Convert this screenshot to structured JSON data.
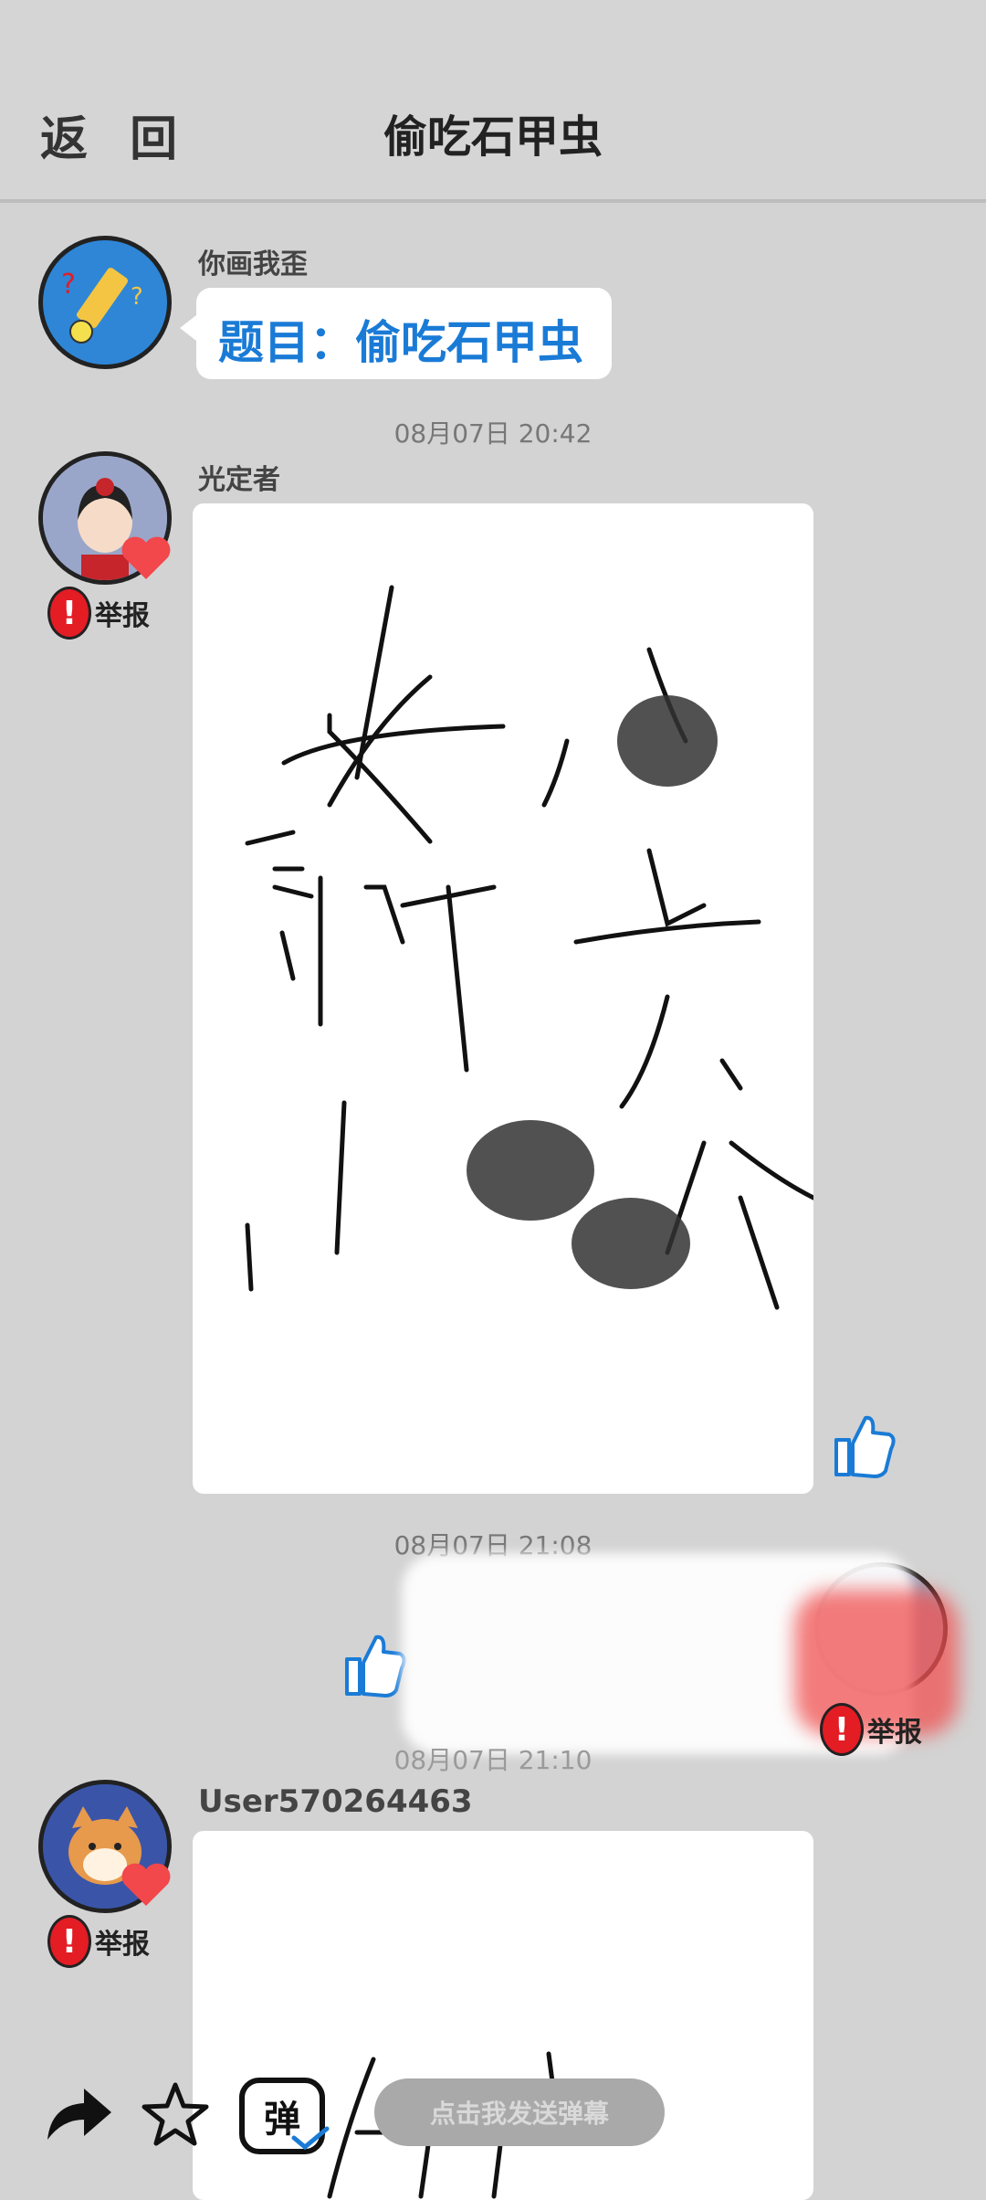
{
  "header": {
    "back_label": "返 回",
    "title": "偷吃石甲虫"
  },
  "messages": [
    {
      "sender": "你画我歪",
      "topic": "题目：偷吃石甲虫"
    },
    {
      "timestamp": "08月07日  20:42",
      "sender": "光定者",
      "report_label": "举报"
    },
    {
      "timestamp": "08月07日  21:08"
    },
    {
      "timestamp": "08月07日  21:10",
      "sender": "User570264463",
      "report_label": "举报"
    }
  ],
  "own_message": {
    "report_label": "举报"
  },
  "bottom_bar": {
    "danmaku_placeholder": "点击我发送弹幕",
    "danmaku_icon_text": "弹",
    "icons": [
      "share-icon",
      "star-icon",
      "danmaku-icon"
    ]
  },
  "colors": {
    "accent": "#1a7bd6",
    "report": "#e41c24",
    "heart": "#f2474b"
  }
}
